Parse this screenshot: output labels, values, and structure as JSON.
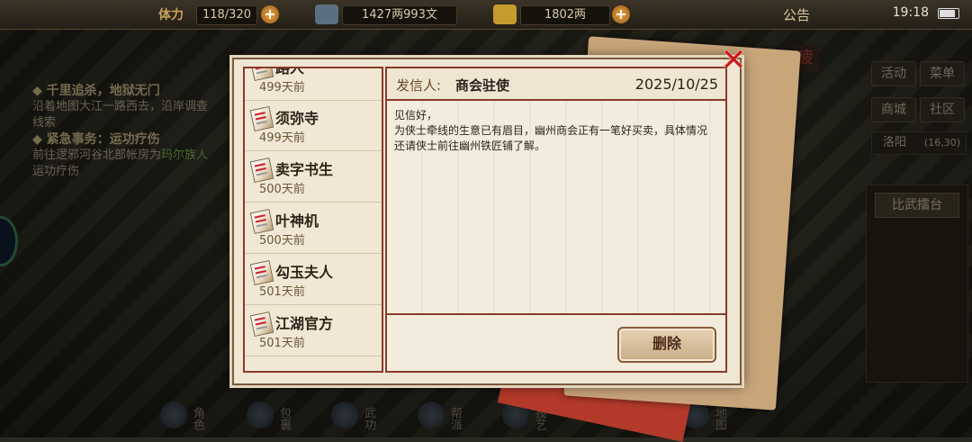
{
  "topbar": {
    "stamina_label": "体力",
    "stamina_value": "118/320",
    "money_value": "1427两993文",
    "gold_value": "1802两",
    "announce_label": "公告",
    "clock": "19:18"
  },
  "quest": {
    "q1_title": "千里追杀，地狱无门",
    "q1_desc": "沿着地图大江一路西去，沿岸调查线索",
    "q2_title": "紧急事务：运功疗伤",
    "q2_desc_pre": "前往逻邪河谷北部帐房为",
    "q2_highlight": "玛尔族人",
    "q2_desc_post": "运功疗伤"
  },
  "right_menu": {
    "activity": "活动",
    "menu": "菜单",
    "shop": "商城",
    "community": "社区",
    "city": "洛阳",
    "coords": "(16,30)",
    "fatigue": "疲",
    "arena": "比武擂台"
  },
  "bottom_bar": [
    "角色",
    "包裹",
    "武功",
    "帮派",
    "技艺",
    "地图"
  ],
  "mail": {
    "items": [
      {
        "name": "路人",
        "age": "499天前"
      },
      {
        "name": "须弥寺",
        "age": "499天前"
      },
      {
        "name": "卖字书生",
        "age": "500天前"
      },
      {
        "name": "叶神机",
        "age": "500天前"
      },
      {
        "name": "勾玉夫人",
        "age": "501天前"
      },
      {
        "name": "江湖官方",
        "age": "501天前"
      }
    ],
    "sender_label": "发信人:",
    "sender_name": "商会驻使",
    "date": "2025/10/25",
    "greeting": "见信好，",
    "body": "为侠士牵线的生意已有眉目，幽州商会正有一笔好买卖，具体情况还请侠士前往幽州铁匠铺了解。",
    "delete_label": "删除"
  }
}
